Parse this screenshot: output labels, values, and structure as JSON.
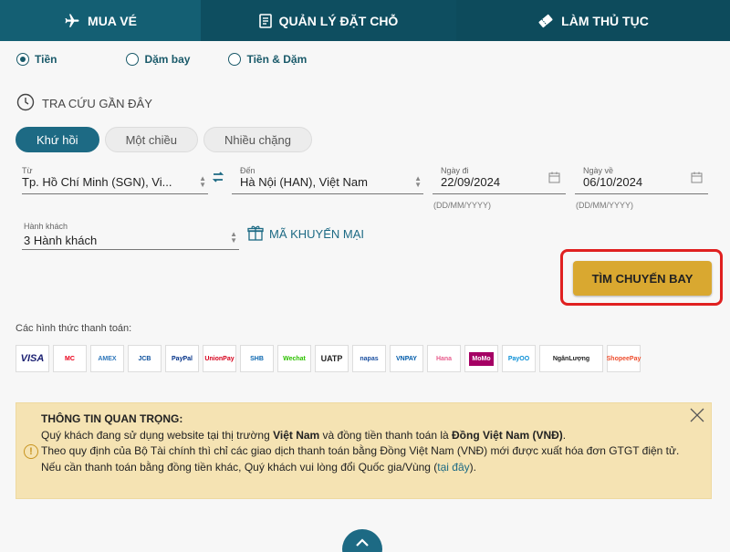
{
  "tabs": [
    {
      "label": "MUA VÉ",
      "icon": "plane-icon"
    },
    {
      "label": "QUẢN LÝ ĐẶT CHỖ",
      "icon": "book-icon"
    },
    {
      "label": "LÀM THỦ TỤC",
      "icon": "ticket-icon"
    }
  ],
  "fare_types": [
    {
      "label": "Tiền",
      "selected": true
    },
    {
      "label": "Dặm bay",
      "selected": false
    },
    {
      "label": "Tiền & Dặm",
      "selected": false
    }
  ],
  "recent_search": "TRA CỨU GẦN ĐÂY",
  "trip_types": [
    {
      "label": "Khứ hồi",
      "active": true
    },
    {
      "label": "Một chiều",
      "active": false
    },
    {
      "label": "Nhiều chặng",
      "active": false
    }
  ],
  "from": {
    "label": "Từ",
    "value": "Tp. Hồ Chí Minh (SGN), Vi..."
  },
  "to": {
    "label": "Đến",
    "value": "Hà Nội (HAN), Việt Nam"
  },
  "depart": {
    "label": "Ngày đi",
    "value": "22/09/2024",
    "hint": "(DD/MM/YYYY)"
  },
  "return": {
    "label": "Ngày về",
    "value": "06/10/2024",
    "hint": "(DD/MM/YYYY)"
  },
  "passengers": {
    "label": "Hành khách",
    "value": "3 Hành khách"
  },
  "promo": "MÃ KHUYẾN MẠI",
  "search_button": "TÌM CHUYẾN BAY",
  "payment_label": "Các hình thức thanh toán:",
  "payments": [
    "VISA",
    "MC",
    "AMEX",
    "JCB",
    "PayPal",
    "UnionPay",
    "SHB",
    "Wechat",
    "UATP",
    "napas",
    "VNPAY",
    "Hana",
    "MoMo",
    "PayOO",
    "NgânLượng",
    "ShopeePay"
  ],
  "info": {
    "title": "THÔNG TIN QUAN TRỌNG:",
    "l1_a": "Quý khách đang sử dụng website tại thị trường ",
    "l1_b": "Việt Nam",
    "l1_c": " và đồng tiền thanh toán là ",
    "l1_d": "Đồng Việt Nam (VNĐ)",
    "l1_e": ".",
    "l2": "Theo quy định của Bộ Tài chính thì chỉ các giao dịch thanh toán bằng Đồng Việt Nam (VNĐ) mới được xuất hóa đơn GTGT điện tử.",
    "l3_a": "Nếu cần thanh toán bằng đồng tiền khác, Quý khách vui lòng đổi Quốc gia/Vùng (",
    "l3_link": "tại đây",
    "l3_b": ")."
  },
  "colors": {
    "primary": "#1d6a84",
    "header": "#0d4c5d",
    "button": "#d9a830",
    "highlight": "#e02020"
  }
}
